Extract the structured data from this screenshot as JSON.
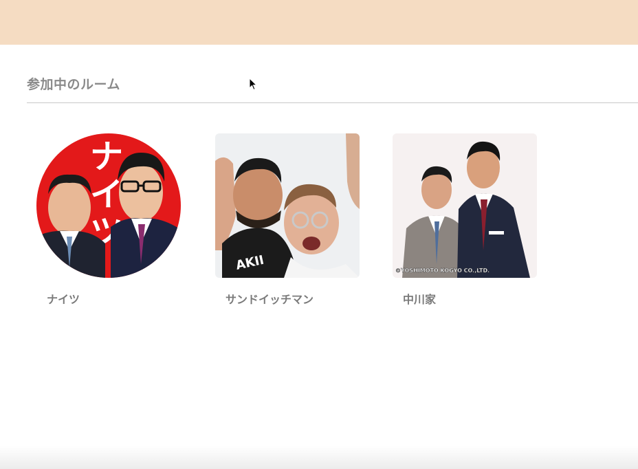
{
  "section": {
    "title": "参加中のルーム"
  },
  "rooms": [
    {
      "name": "ナイツ",
      "thumb_text": "ナイツ",
      "thumb_shape": "circle",
      "accent": "#e0201b"
    },
    {
      "name": "サンドイッチマン",
      "thumb_text": "AKII",
      "thumb_shape": "rounded",
      "accent": "#1e1e1e"
    },
    {
      "name": "中川家",
      "thumb_text": "©YOSHIMOTO KOGYO CO.,LTD.",
      "thumb_shape": "rounded",
      "accent": "#2a3550"
    }
  ],
  "colors": {
    "header_bg": "#f5dcc2",
    "title_text": "#8a8a8a",
    "divider": "#c8c8c8"
  },
  "cursor": {
    "icon": "arrow-cursor-icon"
  }
}
